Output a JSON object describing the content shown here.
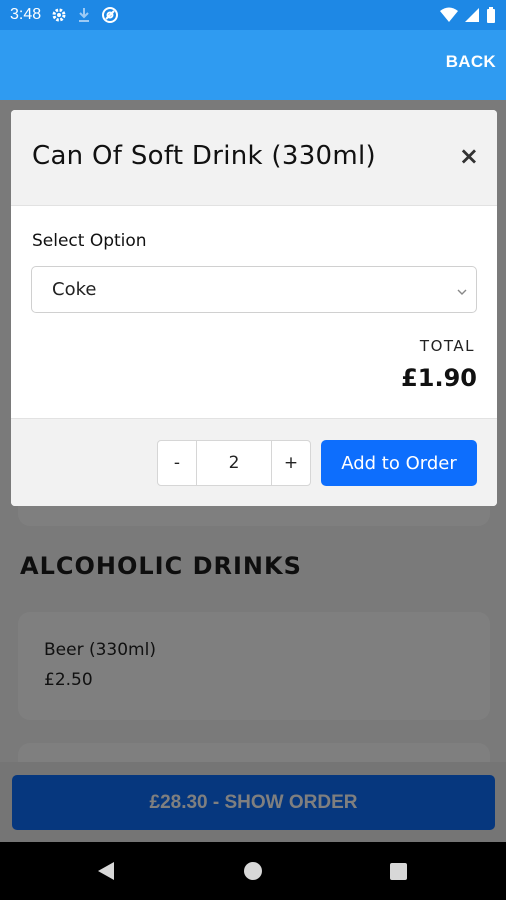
{
  "status_bar": {
    "time": "3:48",
    "icons": [
      "settings-icon",
      "download-icon",
      "at-sign-icon",
      "wifi-icon",
      "signal-icon",
      "battery-icon"
    ]
  },
  "app_bar": {
    "back_label": "BACK"
  },
  "page": {
    "section_heading": "ALCOHOLIC DRINKS",
    "items": [
      {
        "name": "Beer (330ml)",
        "price": "£2.50"
      }
    ]
  },
  "modal": {
    "title": "Can Of Soft Drink (330ml)",
    "close": "×",
    "option_label": "Select Option",
    "selected_option": "Coke",
    "total_label": "TOTAL",
    "total_value": "£1.90",
    "quantity": "2",
    "minus": "-",
    "plus": "+",
    "add_label": "Add to Order"
  },
  "order_bar": {
    "label": "£28.30 - SHOW ORDER"
  },
  "colors": {
    "status_bar": "#1e88e5",
    "app_bar": "#2f9bf1",
    "primary_button": "#0d6efd"
  }
}
